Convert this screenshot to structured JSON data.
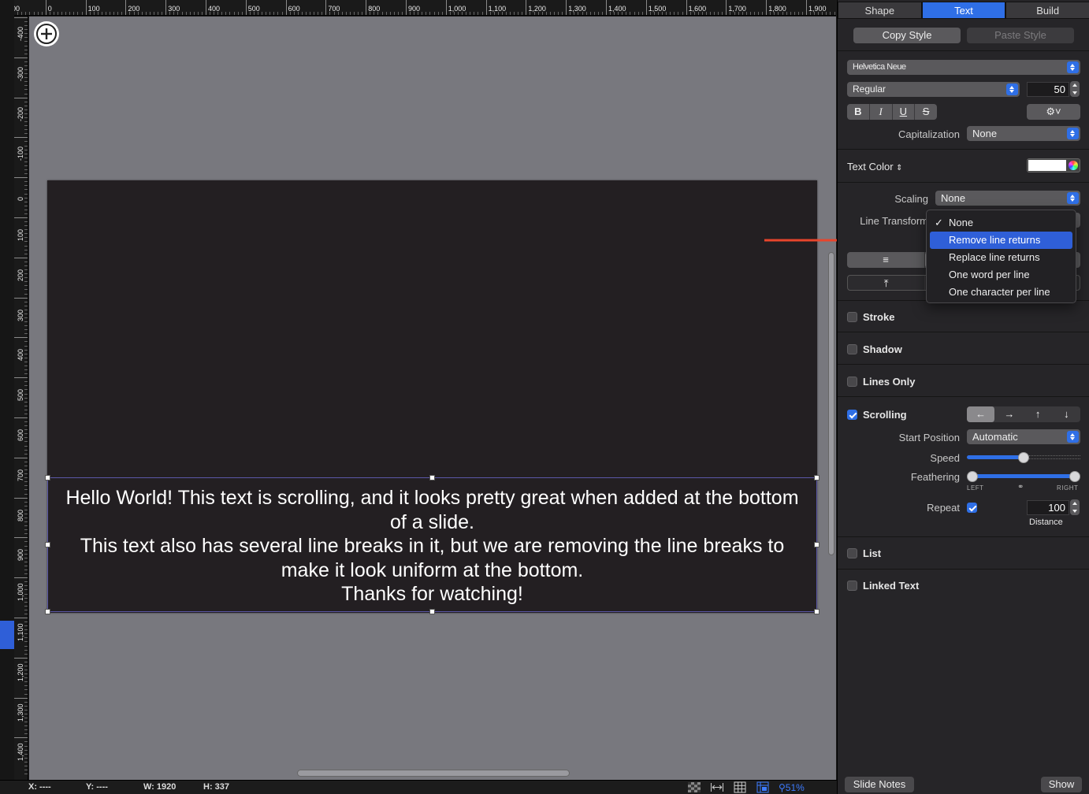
{
  "ruler": {
    "top_labels": [
      "100",
      "0",
      "100",
      "200",
      "300",
      "400",
      "500",
      "600",
      "700",
      "800",
      "900",
      "1,000",
      "1,100",
      "1,200",
      "1,300",
      "1,400",
      "1,500",
      "1,600",
      "1,700",
      "1,800",
      "1,900"
    ],
    "left_labels": [
      "-400",
      "-300",
      "-200",
      "-100",
      "0",
      "100",
      "200",
      "300",
      "400",
      "500",
      "600",
      "700",
      "800",
      "900",
      "1,000",
      "1,100",
      "1,200",
      "1,300",
      "1,400"
    ]
  },
  "slide": {
    "text_lines": [
      "Hello World! This text is scrolling, and it looks pretty great when added at the bottom",
      "of a slide.",
      "This text also has several line breaks in it, but we are removing the line breaks to",
      "make it look uniform at the bottom.",
      "Thanks for watching!"
    ],
    "background_color": "#231f22",
    "text_color": "#ffffff"
  },
  "status": {
    "x": "X: ----",
    "y": "Y: ----",
    "w": "W: 1920",
    "h": "H: 337",
    "zoom": "51%"
  },
  "inspector": {
    "tabs": [
      "Shape",
      "Text",
      "Build"
    ],
    "active_tab": "Text",
    "copy_style": "Copy Style",
    "paste_style": "Paste Style",
    "font_family": "Helvetica Neue",
    "font_style": "Regular",
    "font_size": "50",
    "format_buttons": [
      "B",
      "I",
      "U",
      "S"
    ],
    "capitalization_label": "Capitalization",
    "capitalization_value": "None",
    "text_color_label": "Text Color",
    "text_color_value": "#ffffff",
    "scaling_label": "Scaling",
    "scaling_value": "None",
    "line_transform_label": "Line Transform",
    "stroke": "Stroke",
    "shadow": "Shadow",
    "lines_only": "Lines Only",
    "scrolling": "Scrolling",
    "scrolling_checked": true,
    "start_position_label": "Start Position",
    "start_position_value": "Automatic",
    "speed_label": "Speed",
    "speed_fraction": 0.5,
    "feathering_label": "Feathering",
    "feathering_left": "LEFT",
    "feathering_right": "RIGHT",
    "repeat_label": "Repeat",
    "repeat_checked": true,
    "distance_value": "100",
    "distance_label": "Distance",
    "list": "List",
    "linked_text": "Linked Text",
    "slide_notes": "Slide Notes",
    "show": "Show"
  },
  "line_transform_menu": {
    "items": [
      "None",
      "Remove line returns",
      "Replace line returns",
      "One word per line",
      "One character per line"
    ],
    "checked": "None",
    "highlighted": "Remove line returns"
  },
  "accent_color": "#2f6fe6",
  "annotation_arrow_color": "#e8452c"
}
